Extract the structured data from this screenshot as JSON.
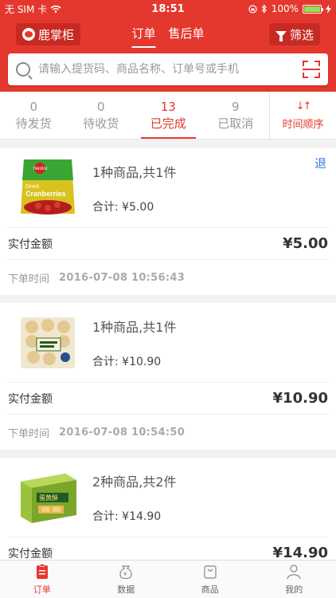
{
  "status_bar": {
    "carrier": "无 SIM 卡",
    "time": "18:51",
    "battery": "100%",
    "battery_level": 1.0
  },
  "nav": {
    "brand": "鹿掌柜",
    "tabs": [
      {
        "label": "订单",
        "active": true
      },
      {
        "label": "售后单",
        "active": false
      }
    ],
    "filter_label": "筛选"
  },
  "search": {
    "placeholder": "请输入提货码、商品名称、订单号或手机"
  },
  "status_tabs": [
    {
      "count": "0",
      "label": "待发货",
      "active": false
    },
    {
      "count": "0",
      "label": "待收货",
      "active": false
    },
    {
      "count": "13",
      "label": "已完成",
      "active": true
    },
    {
      "count": "9",
      "label": "已取消",
      "active": false
    }
  ],
  "sort": {
    "icon": "↓↑",
    "label": "时间顺序"
  },
  "orders": [
    {
      "summary": "1种商品,共1件",
      "total": "合计:  ¥5.00",
      "refund": "退",
      "paid_label": "实付金额",
      "paid_amount": "¥5.00",
      "time_label": "下单时间",
      "time": "2016-07-08 10:56:43",
      "product_icon": "cranberry-bag",
      "thumb_texts": {
        "brand": "Nestor",
        "line1": "Dried",
        "line2": "Cranberries"
      }
    },
    {
      "summary": "1种商品,共1件",
      "total": "合计:  ¥10.90",
      "refund": "",
      "paid_label": "实付金额",
      "paid_amount": "¥10.90",
      "time_label": "下单时间",
      "time": "2016-07-08 10:54:50",
      "product_icon": "rice-cracker-bag",
      "thumb_texts": {
        "brand": "",
        "line1": "",
        "line2": ""
      }
    },
    {
      "summary": "2种商品,共2件",
      "total": "合计:  ¥14.90",
      "refund": "",
      "paid_label": "实付金额",
      "paid_amount": "¥14.90",
      "time_label": "",
      "time": "",
      "product_icon": "biscuit-box",
      "thumb_texts": {
        "brand": "蛋黄酥",
        "line1": "",
        "line2": ""
      }
    }
  ],
  "bottom_nav": [
    {
      "label": "订单",
      "icon": "clipboard-icon",
      "active": true
    },
    {
      "label": "数据",
      "icon": "yen-bag-icon",
      "active": false
    },
    {
      "label": "商品",
      "icon": "shopping-bag-icon",
      "active": false
    },
    {
      "label": "我的",
      "icon": "person-icon",
      "active": false
    }
  ],
  "colors": {
    "primary": "#e4382e",
    "primary_dark": "#c72a22",
    "link": "#3a7be0",
    "battery_green": "#8fe35c"
  }
}
